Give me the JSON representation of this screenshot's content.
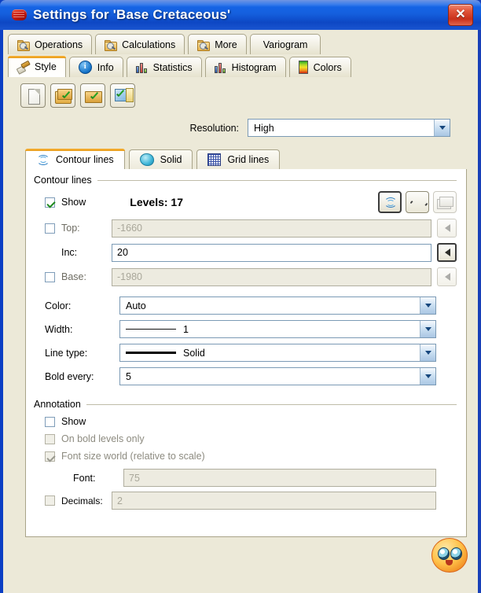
{
  "window": {
    "title": "Settings for 'Base Cretaceous'",
    "app_icon": "app-logo-icon",
    "close_label": "✕"
  },
  "outer_tabs_row1": [
    {
      "label": "Operations",
      "icon": "folder-search-icon",
      "active": false
    },
    {
      "label": "Calculations",
      "icon": "folder-search-icon",
      "active": false
    },
    {
      "label": "More",
      "icon": "folder-search-icon",
      "active": false
    },
    {
      "label": "Variogram",
      "icon": "",
      "active": false
    }
  ],
  "outer_tabs_row2": [
    {
      "label": "Style",
      "icon": "brush-icon",
      "active": true
    },
    {
      "label": "Info",
      "icon": "info-icon",
      "active": false
    },
    {
      "label": "Statistics",
      "icon": "bar-chart-icon",
      "active": false
    },
    {
      "label": "Histogram",
      "icon": "bar-chart-icon",
      "active": false
    },
    {
      "label": "Colors",
      "icon": "color-gradient-icon",
      "active": false
    }
  ],
  "toolbar": [
    {
      "name": "new-document-button",
      "icon": "blank-page-icon"
    },
    {
      "name": "copy-settings-button",
      "icon": "folders-check-icon"
    },
    {
      "name": "apply-settings-button",
      "icon": "folder-check-icon"
    },
    {
      "name": "apply-to-all-button",
      "icon": "apply-check-icon"
    }
  ],
  "resolution": {
    "label": "Resolution:",
    "value": "High"
  },
  "inner_tabs": [
    {
      "label": "Contour lines",
      "icon": "contour-lines-icon",
      "active": true
    },
    {
      "label": "Solid",
      "icon": "solid-fill-icon",
      "active": false
    },
    {
      "label": "Grid lines",
      "icon": "grid-lines-icon",
      "active": false
    }
  ],
  "contour_group": {
    "title": "Contour lines",
    "show_label": "Show",
    "show_checked": true,
    "levels_label": "Levels: 17",
    "mini_buttons": [
      {
        "name": "contour-style-button",
        "icon": "contour-lines-icon",
        "selected": true,
        "disabled": false
      },
      {
        "name": "smooth-line-button",
        "icon": "wave-icon",
        "selected": false,
        "disabled": false
      },
      {
        "name": "stack-image-button",
        "icon": "stacked-images-icon",
        "selected": false,
        "disabled": true
      }
    ],
    "fields": [
      {
        "name": "top",
        "label": "Top:",
        "value": "-1660",
        "checkbox": true,
        "checked": false,
        "disabled": true,
        "spin_selected": false
      },
      {
        "name": "inc",
        "label": "Inc:",
        "value": "20",
        "checkbox": false,
        "checked": false,
        "disabled": false,
        "spin_selected": true
      },
      {
        "name": "base",
        "label": "Base:",
        "value": "-1980",
        "checkbox": true,
        "checked": false,
        "disabled": true,
        "spin_selected": false
      }
    ],
    "combos": [
      {
        "name": "color",
        "label": "Color:",
        "value": "Auto",
        "swatch": "none"
      },
      {
        "name": "width",
        "label": "Width:",
        "value": "1",
        "swatch": "thin-line"
      },
      {
        "name": "line-type",
        "label": "Line type:",
        "value": "Solid",
        "swatch": "bold-line"
      },
      {
        "name": "bold-every",
        "label": "Bold every:",
        "value": "5",
        "swatch": "none"
      }
    ]
  },
  "annotation_group": {
    "title": "Annotation",
    "show_label": "Show",
    "show_checked": false,
    "bold_only_label": "On bold levels only",
    "bold_only_checked": false,
    "font_world_label": "Font size world (relative to scale)",
    "font_world_checked": true,
    "font_label": "Font:",
    "font_value": "75",
    "decimals_label": "Decimals:",
    "decimals_value": "2",
    "decimals_checked": false
  },
  "overlay": {
    "sun_icon": "sun-emoticon-watermark"
  },
  "colors": {
    "title_blue": "#1560DE",
    "client_bg": "#ECE9D8",
    "tab_accent": "#E89B18",
    "field_border": "#7B9AB5"
  }
}
